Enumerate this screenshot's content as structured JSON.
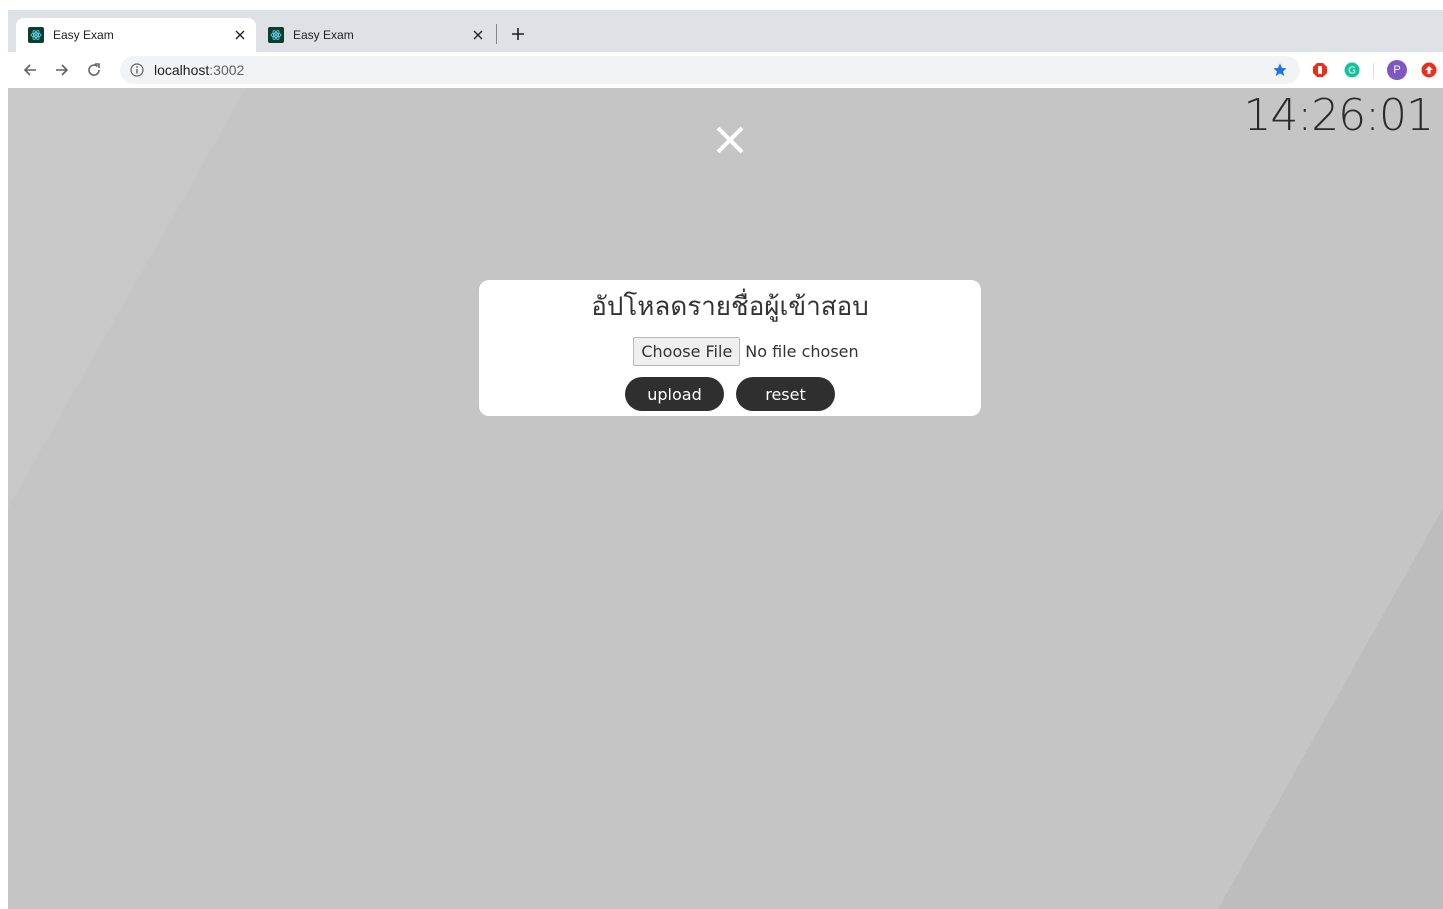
{
  "browser": {
    "tabs": [
      {
        "title": "Easy Exam",
        "active": true
      },
      {
        "title": "Easy Exam",
        "active": false
      }
    ],
    "url_host": "localhost",
    "url_port": ":3002",
    "extensions": [
      "star-bookmark-icon",
      "adblock-icon",
      "grammarly-icon",
      "profile-avatar-icon",
      "extension-icon"
    ],
    "profile_initial": "P",
    "colors": {
      "tabstrip": "#dee1e6",
      "omnibox": "#f1f3f4",
      "bookmark_star": "#1a73e8"
    }
  },
  "page": {
    "clock": "14:26:01",
    "background_color": "#c5c5c5",
    "modal": {
      "title": "อัปโหลดรายชื่อผู้เข้าสอบ",
      "file_button": "Choose File",
      "file_status": "No file chosen",
      "upload_label": "upload",
      "reset_label": "reset"
    },
    "button_color": "#2f2f2f"
  }
}
